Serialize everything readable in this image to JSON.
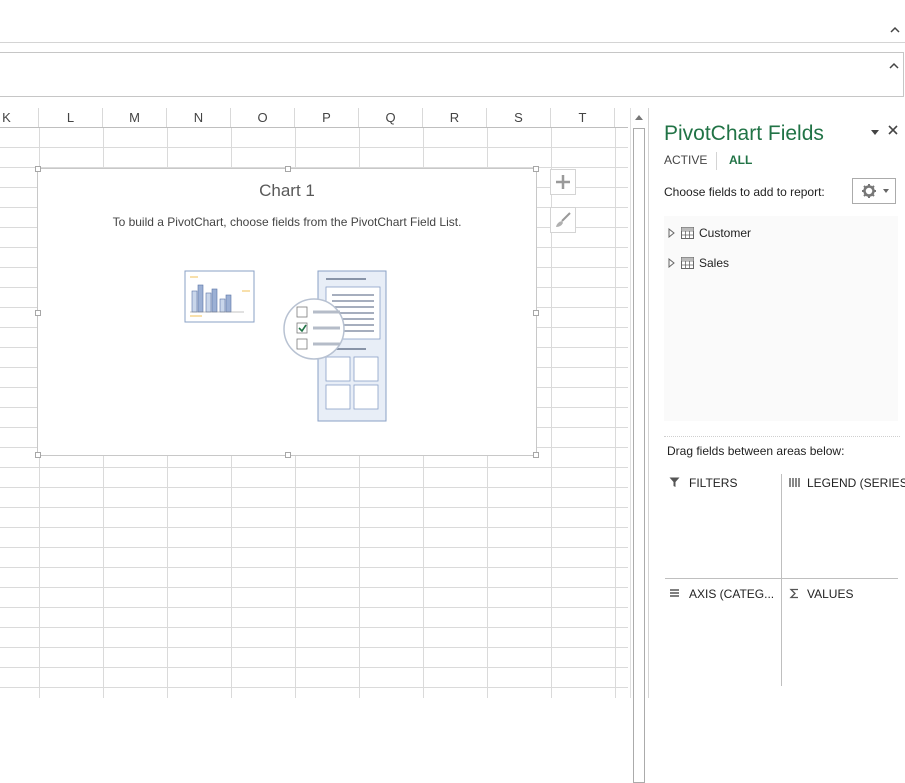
{
  "columns": [
    "K",
    "L",
    "M",
    "N",
    "O",
    "P",
    "Q",
    "R",
    "S",
    "T"
  ],
  "chart": {
    "title": "Chart 1",
    "hint": "To build a PivotChart, choose fields from the PivotChart Field List.",
    "side_buttons": [
      {
        "name": "chart-elements-button",
        "icon": "plus-icon"
      },
      {
        "name": "chart-styles-button",
        "icon": "brush-icon"
      }
    ]
  },
  "pane": {
    "title": "PivotChart Fields",
    "tabs": {
      "active": "ACTIVE",
      "all": "ALL"
    },
    "choose_label": "Choose fields to add to report:",
    "fields": [
      "Customer",
      "Sales"
    ],
    "drag_label": "Drag fields between areas below:",
    "areas": {
      "filters": "FILTERS",
      "legend": "LEGEND (SERIES)",
      "axis": "AXIS (CATEG...",
      "values": "VALUES"
    }
  },
  "colors": {
    "accent": "#217346",
    "gridline": "#dadada",
    "chart_border": "#c8c8c8"
  }
}
